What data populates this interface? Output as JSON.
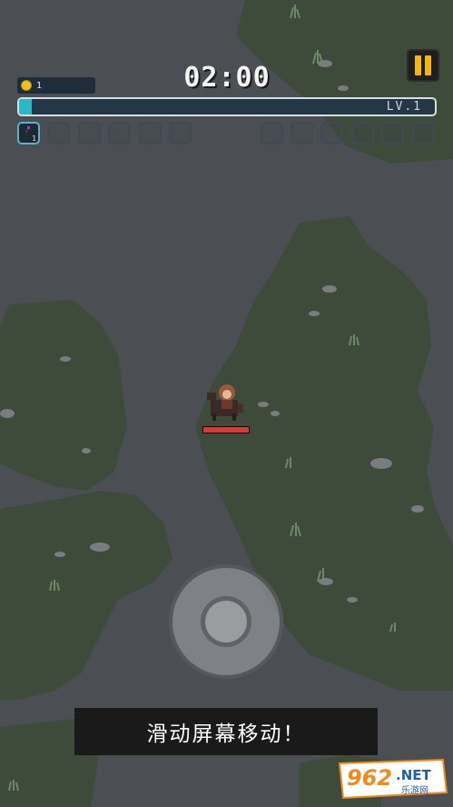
{
  "hud": {
    "coins": "1",
    "timer": "02:00",
    "level_label": "LV.1",
    "xp_progress": 0.03,
    "weapon_slots": [
      {
        "level": "1",
        "icon": "purple-orb-staff-icon"
      },
      {},
      {},
      {},
      {},
      {}
    ],
    "passive_slots": [
      {},
      {},
      {},
      {},
      {},
      {}
    ],
    "pause_icon": "pause-icon"
  },
  "player": {
    "hp_fraction": 1.0
  },
  "hint": {
    "text": "滑动屏幕移动！"
  },
  "watermark": {
    "main": "962",
    "suffix": ".NET",
    "sub": "乐游网"
  },
  "colors": {
    "ground": "#4a4d51",
    "grass": "#3f4a3b",
    "xp_fill": "#2ab9c4",
    "coin": "#f2c21c",
    "pause": "#f5b510",
    "hp": "#d43c3c"
  }
}
